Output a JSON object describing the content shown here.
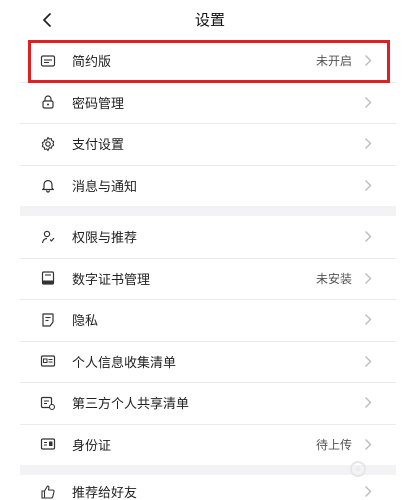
{
  "header": {
    "title": "设置"
  },
  "group1": [
    {
      "label": "简约版",
      "value": "未开启",
      "icon": "simple-mode-icon"
    },
    {
      "label": "密码管理",
      "value": "",
      "icon": "lock-icon"
    },
    {
      "label": "支付设置",
      "value": "",
      "icon": "gear-icon"
    },
    {
      "label": "消息与通知",
      "value": "",
      "icon": "bell-icon"
    }
  ],
  "group2": [
    {
      "label": "权限与推荐",
      "value": "",
      "icon": "permission-icon"
    },
    {
      "label": "数字证书管理",
      "value": "未安装",
      "icon": "certificate-icon"
    },
    {
      "label": "隐私",
      "value": "",
      "icon": "privacy-icon"
    },
    {
      "label": "个人信息收集清单",
      "value": "",
      "icon": "id-card-icon"
    },
    {
      "label": "第三方个人共享清单",
      "value": "",
      "icon": "share-list-icon"
    },
    {
      "label": "身份证",
      "value": "待上传",
      "icon": "identity-card-icon"
    }
  ],
  "group3": [
    {
      "label": "推荐给好友",
      "value": "",
      "icon": "thumbs-up-icon"
    }
  ],
  "colors": {
    "highlight": "#e02020",
    "chevron": "#bcbcbc",
    "separator": "#f3f3f5"
  }
}
